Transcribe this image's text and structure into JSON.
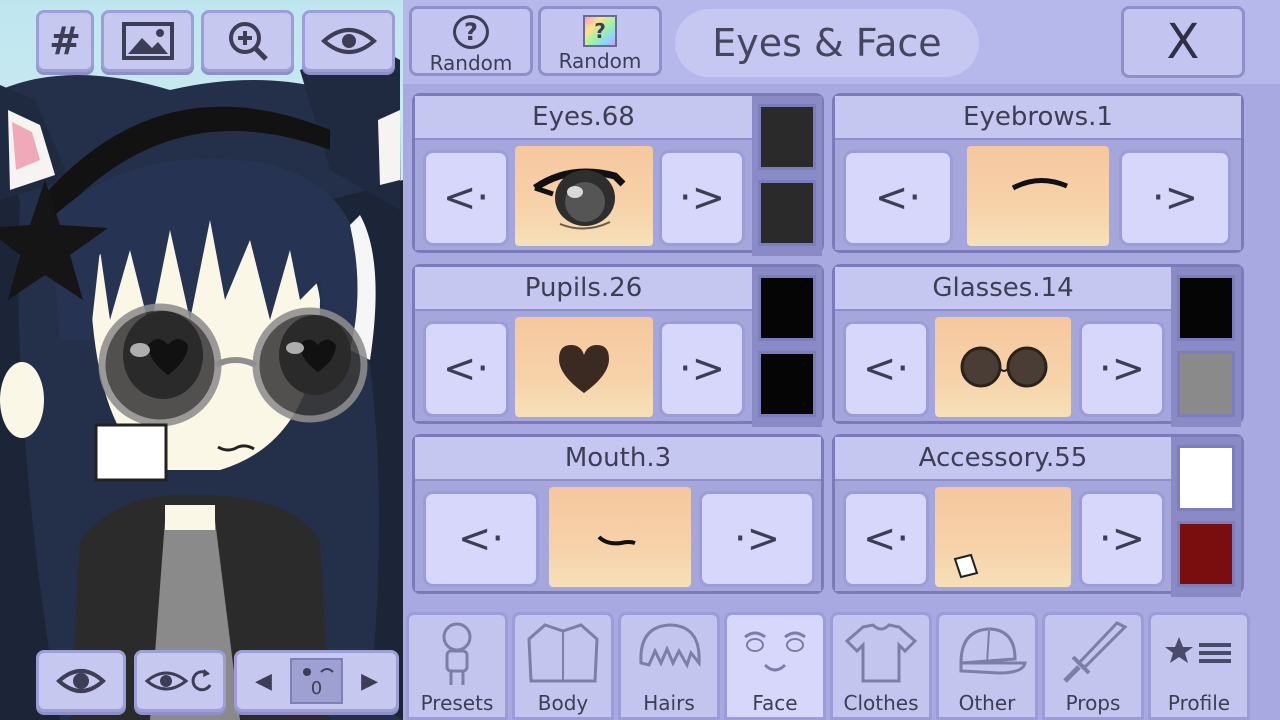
{
  "left_toolbar": {
    "hash_label": "#",
    "bottom_pose_counter": "0"
  },
  "top_bar": {
    "random_1_label": "Random",
    "random_2_label": "Random",
    "random_1_symbol": "?",
    "random_2_symbol": "?",
    "title": "Eyes & Face",
    "close_label": "X"
  },
  "features": [
    {
      "label": "Eyes.68",
      "prev": "<·",
      "next": "·>",
      "colors": [
        "#2a2a2a",
        "#2a2a2a"
      ]
    },
    {
      "label": "Eyebrows.1",
      "prev": "<·",
      "next": "·>",
      "colors": []
    },
    {
      "label": "Pupils.26",
      "prev": "<·",
      "next": "·>",
      "colors": [
        "#050505",
        "#050505"
      ]
    },
    {
      "label": "Glasses.14",
      "prev": "<·",
      "next": "·>",
      "colors": [
        "#050505",
        "#8a8a8a"
      ]
    },
    {
      "label": "Mouth.3",
      "prev": "<·",
      "next": "·>",
      "colors": []
    },
    {
      "label": "Accessory.55",
      "prev": "<·",
      "next": "·>",
      "colors": [
        "#ffffff",
        "#7a0e0e"
      ]
    }
  ],
  "tabs": [
    {
      "label": "Presets",
      "icon": "preset-figure-icon"
    },
    {
      "label": "Body",
      "icon": "body-jacket-icon"
    },
    {
      "label": "Hairs",
      "icon": "hair-icon"
    },
    {
      "label": "Face",
      "icon": "face-icon",
      "active": true
    },
    {
      "label": "Clothes",
      "icon": "shirt-icon"
    },
    {
      "label": "Other",
      "icon": "cap-icon"
    },
    {
      "label": "Props",
      "icon": "sword-icon"
    },
    {
      "label": "Profile",
      "icon": "star-list-icon"
    }
  ]
}
